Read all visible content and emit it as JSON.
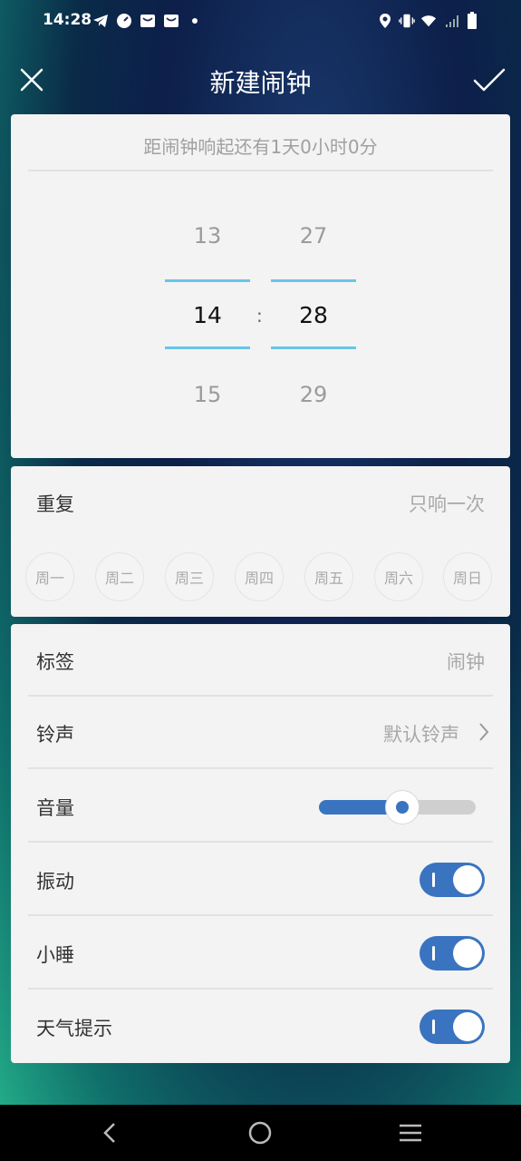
{
  "status_bar": {
    "time": "14:28",
    "left_icons": [
      "telegram-icon",
      "speedometer-icon",
      "mail-icon",
      "mail-icon",
      "dot-icon"
    ],
    "right_icons": [
      "location-icon",
      "vibrate-icon",
      "wifi-icon",
      "signal-icon",
      "battery-icon"
    ]
  },
  "header": {
    "title": "新建闹钟",
    "close_icon": "close-icon",
    "confirm_icon": "check-icon"
  },
  "countdown": {
    "message": "距闹钟响起还有1天0小时0分"
  },
  "time_picker": {
    "hours": {
      "prev": "13",
      "selected": "14",
      "next": "15"
    },
    "minutes": {
      "prev": "27",
      "selected": "28",
      "next": "29"
    },
    "separator": ":"
  },
  "repeat": {
    "label": "重复",
    "value": "只响一次",
    "days": [
      "周一",
      "周二",
      "周三",
      "周四",
      "周五",
      "周六",
      "周日"
    ]
  },
  "settings": {
    "tag": {
      "label": "标签",
      "value": "闹钟"
    },
    "ringtone": {
      "label": "铃声",
      "value": "默认铃声"
    },
    "volume": {
      "label": "音量",
      "level": 0.53
    },
    "vibrate": {
      "label": "振动",
      "on": true
    },
    "snooze": {
      "label": "小睡",
      "on": true
    },
    "weather": {
      "label": "天气提示",
      "on": true
    }
  },
  "colors": {
    "accent": "#3a74c0",
    "picker_line": "#6ac4ea",
    "card_bg": "#f3f3f3"
  },
  "nav_bar": {
    "icons": [
      "back-icon",
      "home-icon",
      "menu-icon"
    ]
  }
}
